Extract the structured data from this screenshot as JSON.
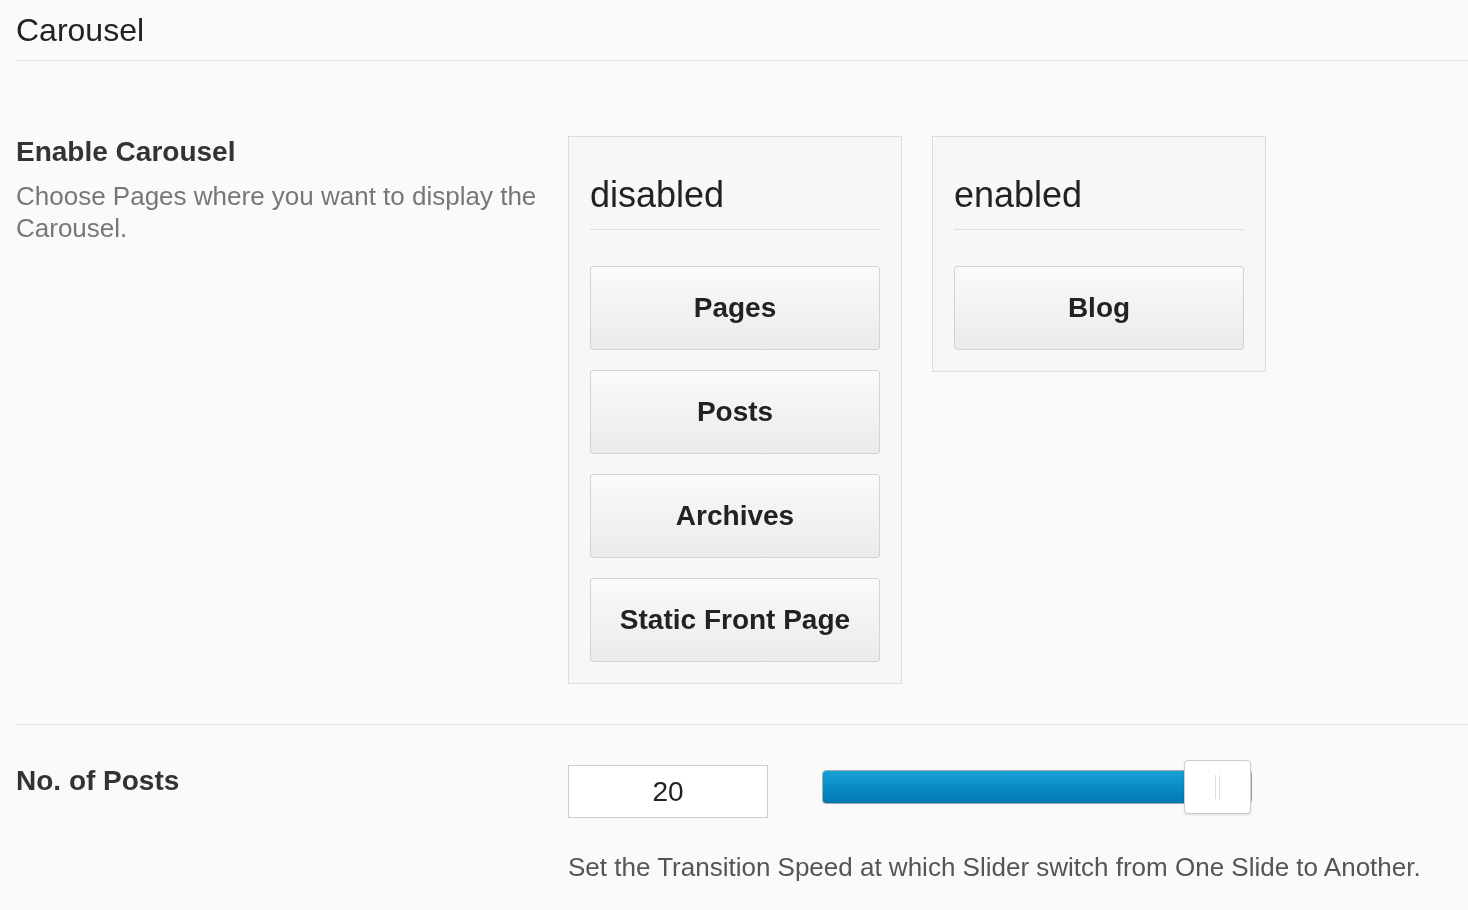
{
  "title": "Carousel",
  "enable_carousel": {
    "label": "Enable Carousel",
    "description": "Choose Pages where you want to display the Carousel.",
    "columns": [
      {
        "title": "disabled",
        "items": [
          "Pages",
          "Posts",
          "Archives",
          "Static Front Page"
        ]
      },
      {
        "title": "enabled",
        "items": [
          "Blog"
        ]
      }
    ]
  },
  "posts": {
    "label": "No. of Posts",
    "value": "20",
    "level": 0.92,
    "hint": "Set the Transition Speed at which Slider switch from One Slide to Another."
  }
}
